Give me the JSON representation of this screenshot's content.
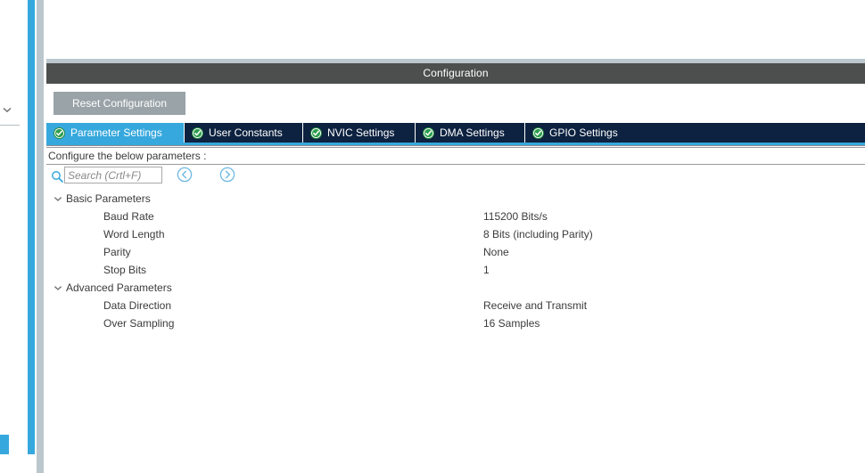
{
  "left_rail": {
    "collapse_icon": "chevron-down-icon",
    "marker_color": "#36a8dd",
    "rail_color": "#36a8dd",
    "gutter_color": "#bcc7cd"
  },
  "panel": {
    "title": "Configuration",
    "title_bar_color": "#4d4f4e"
  },
  "toolbar": {
    "reset_label": "Reset Configuration"
  },
  "tabs": {
    "accent_color": "#36a8dd",
    "inactive_color": "#0d2240",
    "check_icon": "check-circle-icon",
    "items": [
      {
        "label": "Parameter Settings",
        "active": true
      },
      {
        "label": "User Constants",
        "active": false
      },
      {
        "label": "NVIC Settings",
        "active": false
      },
      {
        "label": "DMA Settings",
        "active": false
      },
      {
        "label": "GPIO Settings",
        "active": false
      }
    ]
  },
  "configure_header": {
    "text": "Configure the below parameters :"
  },
  "search": {
    "icon": "search-icon",
    "value": "",
    "placeholder": "Search (Crtl+F)",
    "prev_icon": "circle-left-arrow-icon",
    "next_icon": "circle-right-arrow-icon"
  },
  "parameters": {
    "groups": [
      {
        "label": "Basic Parameters",
        "expanded": true,
        "chevron": "chevron-down-icon",
        "rows": [
          {
            "name": "Baud Rate",
            "value": "115200 Bits/s"
          },
          {
            "name": "Word Length",
            "value": "8 Bits (including Parity)"
          },
          {
            "name": "Parity",
            "value": "None"
          },
          {
            "name": "Stop Bits",
            "value": "1"
          }
        ]
      },
      {
        "label": "Advanced Parameters",
        "expanded": true,
        "chevron": "chevron-down-icon",
        "rows": [
          {
            "name": "Data Direction",
            "value": "Receive and Transmit"
          },
          {
            "name": "Over Sampling",
            "value": "16 Samples"
          }
        ]
      }
    ]
  }
}
